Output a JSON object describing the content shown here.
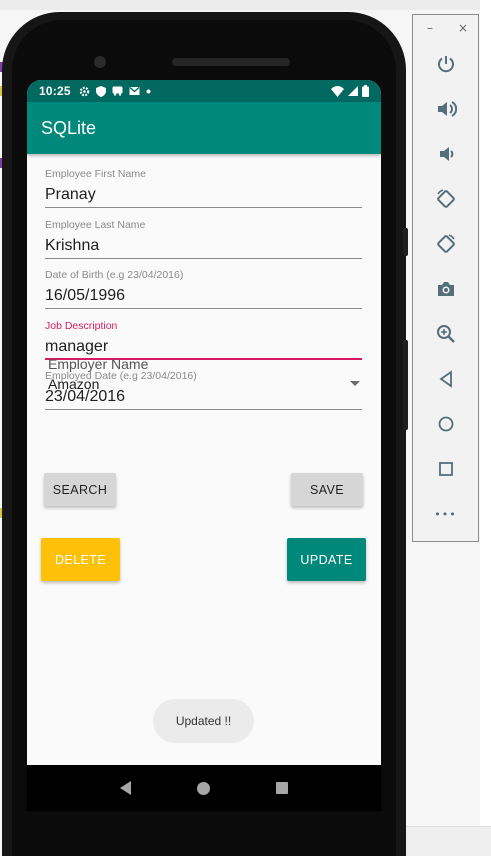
{
  "status_bar": {
    "time": "10:25"
  },
  "app_bar": {
    "title": "SQLite"
  },
  "form": {
    "first_name": {
      "hint": "Employee First Name",
      "value": "Pranay"
    },
    "last_name": {
      "hint": "Employee Last Name",
      "value": "Krishna"
    },
    "dob": {
      "hint": "Date of Birth (e.g 23/04/2016)",
      "value": "16/05/1996"
    },
    "job": {
      "hint": "Job Description",
      "value": "manager"
    },
    "employed": {
      "hint": "Employed Date (e.g 23/04/2016)",
      "value": "23/04/2016"
    },
    "employer": {
      "label": "Employer Name",
      "selected": "Amazon"
    }
  },
  "buttons": {
    "search": "SEARCH",
    "save": "SAVE",
    "delete": "DELETE",
    "update": "UPDATE"
  },
  "toast": {
    "text": "Updated !!"
  },
  "emulator_panel": {
    "minimize": "–",
    "close": "×",
    "tools": [
      "power-icon",
      "volume-up-icon",
      "volume-down-icon",
      "rotate-left-icon",
      "rotate-right-icon",
      "camera-icon",
      "zoom-icon",
      "back-icon",
      "home-icon",
      "overview-icon",
      "more-icon"
    ],
    "more": "•••"
  },
  "colors": {
    "primary": "#00897b",
    "primary_dark": "#01695f",
    "accent": "#d81b60",
    "delete": "#ffc107"
  }
}
